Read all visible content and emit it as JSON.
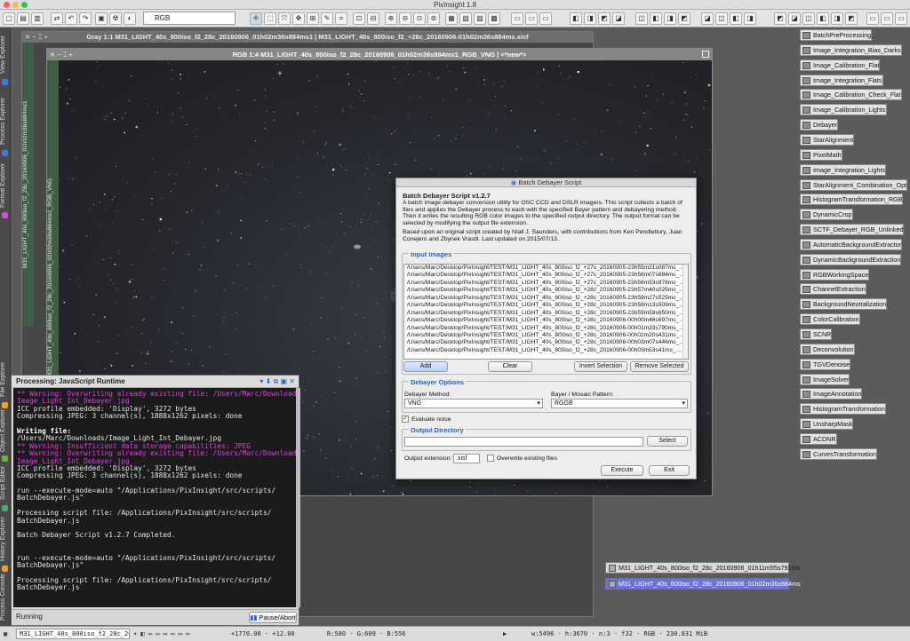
{
  "app": {
    "title": "PixInsight 1.8"
  },
  "toolbar": {
    "color_space": "RGB"
  },
  "left_tabs": [
    "View Explorer",
    "Process Explorer",
    "Format Explorer",
    "File Explorer",
    "Object Explorer",
    "Script Editor",
    "History Explorer",
    "Process Console"
  ],
  "gray_window": {
    "title": "Gray 1:1 M31_LIGHT_40s_800iso_f2_28c_20160906_01h02m36s884ms1 | M31_LIGHT_40s_800iso_f2_+28c_20160906-01h02m36s884ms.xisf",
    "side_label": "M31_LIGHT_40s_800iso_f2_28c_20160906_01h02m36s884ms1"
  },
  "rgb_window": {
    "title": "RGB 1:4 M31_LIGHT_40s_800iso_f2_28c_20160906_01h02m36s884ms1_RGB_VNG | <*new*>",
    "side_label": "M31_LIGHT_40s_800iso_f2_28c_20160906_01h02m36s884ms1_RGB_VNG"
  },
  "process_icons": [
    "BatchPreProcessing",
    "Image_Integration_Bias_Darks",
    "Image_Calibration_Flat",
    "Image_Integration_Flats",
    "Image_Calibration_Check_Flat",
    "Image_Calibration_Lights",
    "Debayer",
    "StarAlignment",
    "PixelMath",
    "Image_Integration_Lights",
    "StarAlignment_Combination_Opt",
    "HistogramTransformation_RGB",
    "DynamicCrop",
    "SCTF_Debayer_RGB_Unlinked",
    "AutomaticBackgroundExtractor",
    "DynamicBackgroundExtraction",
    "RGBWorkingSpace",
    "ChannelExtraction",
    "BackgroundNeutralization",
    "ColorCalibration",
    "SCNR",
    "Deconvolution",
    "TGVDenoise",
    "ImageSolver",
    "ImageAnnotation",
    "HistogramTransformation",
    "UnsharpMask",
    "ACDNR",
    "CurvesTransformation"
  ],
  "image_icons": [
    "M31_LIGHT_40s_800iso_f2_28c_20160906_01h11m55s791ms",
    "M31_LIGHT_40s_800iso_f2_28c_20160906_01h02m36s884ms"
  ],
  "console": {
    "title": "Processing: JavaScript Runtime",
    "lines": [
      {
        "t": "** Warning: Overwriting already existing file: /Users/Marc/Downloads/",
        "c": "#e040e0"
      },
      {
        "t": "Image_Light_Int_Debayer.jpg",
        "c": "#e040e0"
      },
      {
        "t": "ICC profile embedded: 'Display', 3272 bytes",
        "c": "#e8e8e8"
      },
      {
        "t": "Compressing JPEG: 3 channel(s), 1888x1262 pixels: done",
        "c": "#e8e8e8"
      },
      {
        "t": "",
        "c": "#e8e8e8"
      },
      {
        "t": "Writing file:",
        "c": "#ffffff"
      },
      {
        "t": "/Users/Marc/Downloads/Image_Light_Int_Debayer.jpg",
        "c": "#e8e8e8"
      },
      {
        "t": "** Warning: Insufficient data storage capabilities: JPEG",
        "c": "#e040e0"
      },
      {
        "t": "** Warning: Overwriting already existing file: /Users/Marc/Downloads/",
        "c": "#e040e0"
      },
      {
        "t": "Image_Light_Int_Debayer.jpg",
        "c": "#e040e0"
      },
      {
        "t": "ICC profile embedded: 'Display', 3272 bytes",
        "c": "#e8e8e8"
      },
      {
        "t": "Compressing JPEG: 3 channel(s), 1888x1262 pixels: done",
        "c": "#e8e8e8"
      },
      {
        "t": "",
        "c": "#e8e8e8"
      },
      {
        "t": "run --execute-mode=auto \"/Applications/PixInsight/src/scripts/",
        "c": "#e8e8e8"
      },
      {
        "t": "BatchDebayer.js\"",
        "c": "#e8e8e8"
      },
      {
        "t": "",
        "c": "#e8e8e8"
      },
      {
        "t": "Processing script file: /Applications/PixInsight/src/scripts/",
        "c": "#e8e8e8"
      },
      {
        "t": "BatchDebayer.js",
        "c": "#e8e8e8"
      },
      {
        "t": "",
        "c": "#e8e8e8"
      },
      {
        "t": "Batch Debayer Script v1.2.7 Completed.",
        "c": "#e8e8e8"
      },
      {
        "t": "",
        "c": "#e8e8e8"
      },
      {
        "t": "",
        "c": "#e8e8e8"
      },
      {
        "t": "run --execute-mode=auto \"/Applications/PixInsight/src/scripts/",
        "c": "#e8e8e8"
      },
      {
        "t": "BatchDebayer.js\"",
        "c": "#e8e8e8"
      },
      {
        "t": "",
        "c": "#e8e8e8"
      },
      {
        "t": "Processing script file: /Applications/PixInsight/src/scripts/",
        "c": "#e8e8e8"
      },
      {
        "t": "BatchDebayer.js",
        "c": "#e8e8e8"
      }
    ],
    "status": "Running",
    "pause_label": "Pause/Abort"
  },
  "dialog": {
    "window_title": "Batch Debayer Script",
    "heading": "Batch Debayer Script v1.2.7",
    "description": "A batch image debayer conversion utility for OSC CCD and DSLR imagers. This script collects a batch of files and applies the Debayer process to each with the specified Bayer pattern and debayering method. Then it writes the resulting RGB color images to the specified output directory. The output format can be selected by modifying the output file extension.",
    "credits": "Based upon an original script created by Niall J. Saunders, with contributions from Ken Pendlebury, Juan Conejero and Zbynek Vrastil. Last updated on 2015/07/13.",
    "input_images_label": "Input Images",
    "files": [
      "/Users/Marc/Desktop/PixInsight/TEST/M31_LIGHT_40s_800iso_f2_+27c_20160905-23h55m21s087ms_...",
      "/Users/Marc/Desktop/PixInsight/TEST/M31_LIGHT_40s_800iso_f2_+27c_20160905-23h56m07s884ms_...",
      "/Users/Marc/Desktop/PixInsight/TEST/M31_LIGHT_40s_800iso_f2_+27c_20160905-23h56m53s978ms_...",
      "/Users/Marc/Desktop/PixInsight/TEST/M31_LIGHT_40s_800iso_f2_+28c_20160905-23h57m40s025ms_...",
      "/Users/Marc/Desktop/PixInsight/TEST/M31_LIGHT_40s_800iso_f2_+28c_20160905-23h58m27s525ms_...",
      "/Users/Marc/Desktop/PixInsight/TEST/M31_LIGHT_40s_800iso_f2_+28c_20160905-23h59m13s509ms_...",
      "/Users/Marc/Desktop/PixInsight/TEST/M31_LIGHT_40s_800iso_f2_+28c_20160905-23h59m59s650ms_...",
      "/Users/Marc/Desktop/PixInsight/TEST/M31_LIGHT_40s_800iso_f2_+28c_20160906-00h00m46s697ms_...",
      "/Users/Marc/Desktop/PixInsight/TEST/M31_LIGHT_40s_800iso_f2_+28c_20160906-00h01m33s790ms_...",
      "/Users/Marc/Desktop/PixInsight/TEST/M31_LIGHT_40s_800iso_f2_+28c_20160906-00h02m20s431ms_...",
      "/Users/Marc/Desktop/PixInsight/TEST/M31_LIGHT_40s_800iso_f2_+28c_20160906-00h03m07s446ms_...",
      "/Users/Marc/Desktop/PixInsight/TEST/M31_LIGHT_40s_800iso_f2_+28c_20160906-00h03m53s41ms_..."
    ],
    "add_label": "Add",
    "clear_label": "Clear",
    "invert_label": "Invert Selection",
    "remove_label": "Remove Selected",
    "debayer_options_label": "Debayer Options",
    "method_label": "Debayer Method:",
    "method_value": "VNG",
    "pattern_label": "Bayer / Mosaic Pattern:",
    "pattern_value": "RGGB",
    "evaluate_noise_label": "Evaluate noise",
    "output_dir_label": "Output Directory",
    "select_label": "Select",
    "output_ext_label": "Output extension:",
    "output_ext_value": ".xisf",
    "overwrite_label": "Overwrite existing files",
    "execute_label": "Execute",
    "exit_label": "Exit"
  },
  "status_bar": {
    "view": "M31_LIGHT_40s_800iso_f2_28c_20160",
    "coords": "+1776.00 · +12.00",
    "rgb": "R:580 · G:609 · B:556",
    "geometry": "w:5496 · h:3670 · n:3 · f32 · RGB · 230.831 MiB"
  }
}
